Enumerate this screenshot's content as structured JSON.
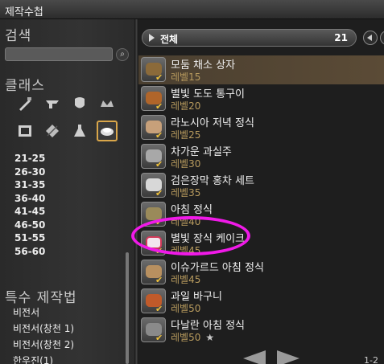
{
  "window": {
    "title": "제작수첩"
  },
  "left": {
    "search_heading": "검색",
    "search_button_icon": "search-icon",
    "class_heading": "클래스",
    "classes": [
      {
        "icon": "carpenter-icon"
      },
      {
        "icon": "blacksmith-icon"
      },
      {
        "icon": "armorer-icon"
      },
      {
        "icon": "goldsmith-icon"
      },
      {
        "icon": "leatherworker-icon"
      },
      {
        "icon": "weaver-icon"
      },
      {
        "icon": "alchemist-icon"
      },
      {
        "icon": "culinarian-icon",
        "selected": true
      }
    ],
    "level_ranges": [
      "21-25",
      "26-30",
      "31-35",
      "36-40",
      "41-45",
      "46-50",
      "51-55",
      "56-60"
    ],
    "special_heading": "특수 제작법",
    "special_items": [
      "비전서",
      "비전서(창천 1)",
      "비전서(창천 2)",
      "한우진(1)"
    ]
  },
  "right": {
    "filter": {
      "label": "전체",
      "count": "21"
    },
    "items": [
      {
        "name": "모둠 채소 상자",
        "level": "레벨15",
        "selected": true
      },
      {
        "name": "별빛 도도 통구이",
        "level": "레벨20"
      },
      {
        "name": "라노시아 저녁 정식",
        "level": "레벨25"
      },
      {
        "name": "차가운 과실주",
        "level": "레벨30"
      },
      {
        "name": "검은장막 홍차 세트",
        "level": "레벨35"
      },
      {
        "name": "아침 정식",
        "level": "레벨40"
      },
      {
        "name": "별빛 장식 케이크",
        "level": "레벨45"
      },
      {
        "name": "이슈가르드 아침 정식",
        "level": "레벨45"
      },
      {
        "name": "과일 바구니",
        "level": "레벨50"
      },
      {
        "name": "다날란 아침 정식",
        "level": "레벨50",
        "star": "★"
      }
    ],
    "page_indicator": "1-2"
  },
  "colors": {
    "selection_border": "#d9a64a",
    "annotation": "#f01ae8",
    "level_text": "#b89b5e",
    "check": "#f0c23b"
  }
}
